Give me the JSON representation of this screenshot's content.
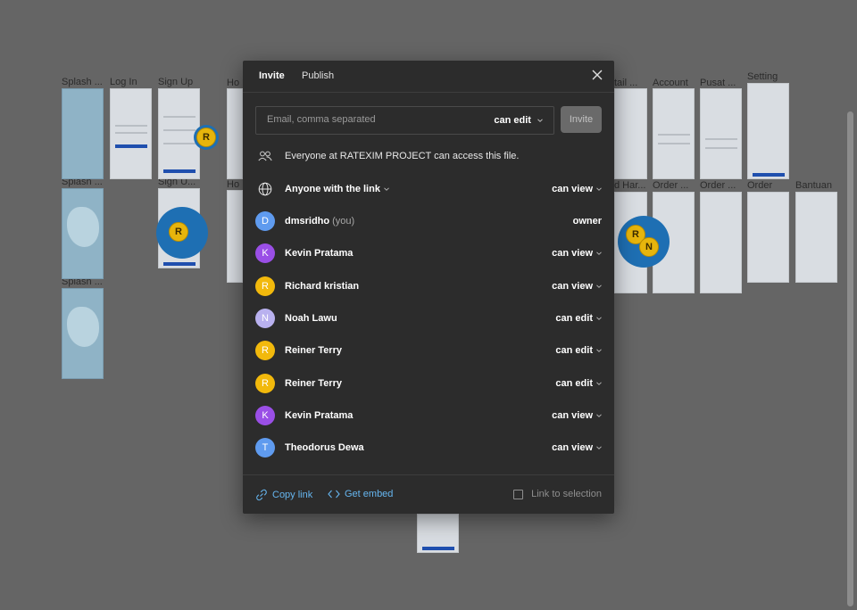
{
  "canvas": {
    "frame_labels": [
      "Splash ...",
      "Log In",
      "Sign Up",
      "Ho",
      "Splash ...",
      "Sign U...",
      "Ho",
      "Splash ...",
      "tail ...",
      "Account",
      "Pusat ...",
      "Setting",
      "d Har...",
      "Order ...",
      "Order ...",
      "Order",
      "Bantuan"
    ],
    "cursors": [
      {
        "initial": "R"
      },
      {
        "initial": "R"
      },
      {
        "initial": "R"
      },
      {
        "initial": "N"
      }
    ]
  },
  "modal": {
    "tabs": [
      {
        "label": "Invite",
        "active": true
      },
      {
        "label": "Publish",
        "active": false
      }
    ],
    "close_icon": "close-icon",
    "email": {
      "placeholder": "Email, comma separated",
      "value": "",
      "permission": "can edit",
      "invite_label": "Invite"
    },
    "team_access": {
      "icon": "people-icon",
      "text": "Everyone at RATEXIM PROJECT can access this file."
    },
    "link_access": {
      "icon": "globe-icon",
      "label": "Anyone with the link",
      "permission": "can view"
    },
    "members": [
      {
        "initial": "D",
        "name": "dmsridho",
        "suffix": "(you)",
        "permission": "owner",
        "color": "#5f9bef"
      },
      {
        "initial": "K",
        "name": "Kevin Pratama",
        "suffix": "",
        "permission": "can view",
        "color": "#9a4fe6"
      },
      {
        "initial": "R",
        "name": "Richard kristian",
        "suffix": "",
        "permission": "can view",
        "color": "#f2b90c"
      },
      {
        "initial": "N",
        "name": "Noah Lawu",
        "suffix": "",
        "permission": "can edit",
        "color": "#b9b1ef"
      },
      {
        "initial": "R",
        "name": "Reiner Terry",
        "suffix": "",
        "permission": "can edit",
        "color": "#f2b90c"
      },
      {
        "initial": "R",
        "name": "Reiner Terry",
        "suffix": "",
        "permission": "can edit",
        "color": "#f2b90c"
      },
      {
        "initial": "K",
        "name": "Kevin Pratama",
        "suffix": "",
        "permission": "can view",
        "color": "#9a4fe6"
      },
      {
        "initial": "T",
        "name": "Theodorus Dewa",
        "suffix": "",
        "permission": "can view",
        "color": "#5f9bef"
      }
    ],
    "footer": {
      "copy_link": "Copy link",
      "get_embed": "Get embed",
      "link_to_selection": "Link to selection"
    }
  }
}
